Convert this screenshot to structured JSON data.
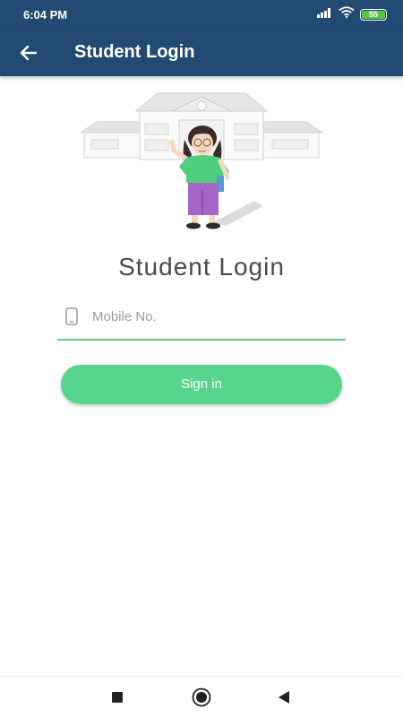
{
  "status_bar": {
    "time": "6:04 PM",
    "battery_level": "55",
    "icons": [
      "signal-icon",
      "wifi-icon",
      "battery-icon"
    ]
  },
  "app_bar": {
    "title": "Student Login",
    "back_icon": "arrow-left-icon"
  },
  "illustration": {
    "description_icon": "school-student-illustration"
  },
  "login": {
    "heading": "Student Login",
    "mobile_placeholder": "Mobile No.",
    "mobile_value": "",
    "signin_label": "Sign in"
  },
  "colors": {
    "primary": "#234a72",
    "accent": "#58d58c",
    "underline": "#5ccb8d"
  },
  "nav_bar": {
    "icons": [
      "recents-square-icon",
      "home-circle-icon",
      "back-triangle-icon"
    ]
  }
}
